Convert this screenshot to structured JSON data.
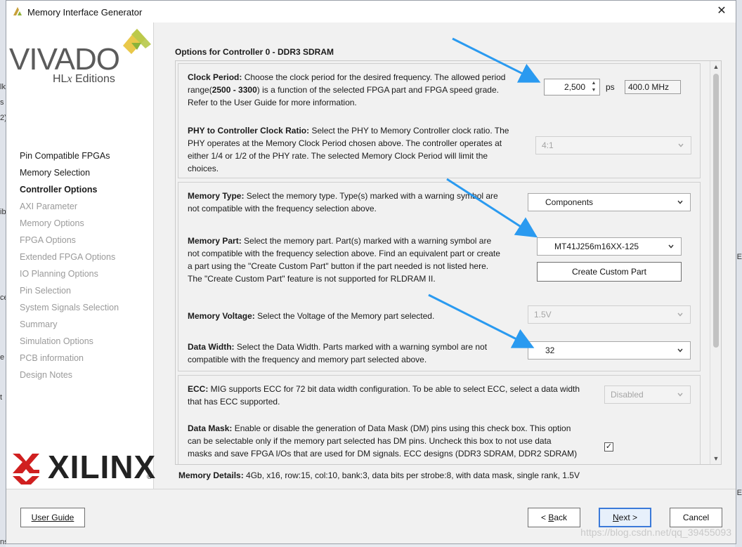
{
  "window": {
    "title": "Memory Interface Generator",
    "close_glyph": "✕"
  },
  "sidebar": {
    "logo_main": "VIVADO",
    "logo_sub_prefix": "HL",
    "logo_sub_x": "x",
    "logo_sub_suffix": " Editions",
    "steps": [
      {
        "label": "Pin Compatible FPGAs",
        "state": "done"
      },
      {
        "label": "Memory Selection",
        "state": "done"
      },
      {
        "label": "Controller Options",
        "state": "active"
      },
      {
        "label": "AXI Parameter",
        "state": "todo"
      },
      {
        "label": "Memory Options",
        "state": "todo"
      },
      {
        "label": "FPGA Options",
        "state": "todo"
      },
      {
        "label": "Extended FPGA Options",
        "state": "todo"
      },
      {
        "label": "IO Planning Options",
        "state": "todo"
      },
      {
        "label": "Pin Selection",
        "state": "todo"
      },
      {
        "label": "System Signals Selection",
        "state": "todo"
      },
      {
        "label": "Summary",
        "state": "todo"
      },
      {
        "label": "Simulation Options",
        "state": "todo"
      },
      {
        "label": "PCB information",
        "state": "todo"
      },
      {
        "label": "Design Notes",
        "state": "todo"
      }
    ],
    "brand": "XILINX",
    "brand_reg": "®"
  },
  "main": {
    "title": "Options for Controller 0 - DDR3 SDRAM",
    "clock_period": {
      "label": "Clock Period:",
      "text1": " Choose the clock period for the desired frequency. The allowed period",
      "text2a": "range(",
      "text2b": "2500 - 3300",
      "text2c": ") is a function of the selected FPGA part and FPGA speed grade.",
      "text3": "Refer to the User Guide for more information.",
      "value": "2,500",
      "unit": "ps",
      "freq": "400.0 MHz"
    },
    "phy_ratio": {
      "label": "PHY to Controller Clock Ratio:",
      "text1": " Select the PHY to Memory Controller clock ratio. The",
      "text2": "PHY operates at the Memory Clock Period chosen above. The controller operates at",
      "text3": "either 1/4 or 1/2 of the PHY rate. The selected Memory Clock Period will limit the",
      "text4": "choices.",
      "value": "4:1"
    },
    "memory_type": {
      "label": "Memory Type:",
      "text1": " Select the memory type. Type(s) marked with a warning symbol are",
      "text2": "not compatible with the frequency selection above.",
      "value": "Components"
    },
    "memory_part": {
      "label": "Memory Part:",
      "text1": " Select the memory part. Part(s) marked with a warning symbol are",
      "text2": "not compatible with the frequency selection above. Find an equivalent part or create",
      "text3": "a part using the \"Create Custom Part\" button if the part needed is not listed here.",
      "text4": "The \"Create Custom Part\" feature is not supported for RLDRAM II.",
      "value": "MT41J256m16XX-125",
      "custom_btn": "Create Custom Part"
    },
    "memory_voltage": {
      "label": "Memory Voltage:",
      "text1": " Select the Voltage of the Memory part selected.",
      "value": "1.5V"
    },
    "data_width": {
      "label": "Data Width:",
      "text1": " Select the Data Width. Parts marked with a warning symbol are not",
      "text2": "compatible with the frequency and memory part selected above.",
      "value": "32"
    },
    "ecc": {
      "label": "ECC:",
      "text1": " MIG supports ECC for 72 bit data width configuration. To be able to select ECC, select a data width",
      "text2": "that has ECC supported.",
      "value": "Disabled"
    },
    "data_mask": {
      "label": "Data Mask:",
      "text1": " Enable or disable the generation of Data Mask (DM) pins using this check box. This option",
      "text2": "can be selectable only if the memory part selected has DM pins. Uncheck this box to not use data",
      "text3": "masks and save FPGA I/Os that are used for DM signals. ECC designs (DDR3 SDRAM, DDR2 SDRAM)",
      "checked_glyph": "✓"
    },
    "details_label": "Memory Details:",
    "details_text": " 4Gb, x16, row:15, col:10, bank:3, data bits per strobe:8, with data mask, single rank, 1.5V"
  },
  "footer": {
    "user_guide": "User Guide",
    "back_prefix": "< ",
    "back_u": "B",
    "back_rest": "ack",
    "next_u": "N",
    "next_rest": "ext >",
    "cancel": "Cancel"
  },
  "background": {
    "left_fragments": [
      "lk",
      "s",
      "2)",
      "ib",
      "ce",
      "e",
      "t",
      "ns"
    ],
    "right_fragments": [
      "E",
      "E"
    ]
  },
  "watermark": "https://blog.csdn.net/qq_39455093",
  "colors": {
    "accent_arrow": "#2a9af0",
    "primary_border": "#3b7ad9"
  }
}
